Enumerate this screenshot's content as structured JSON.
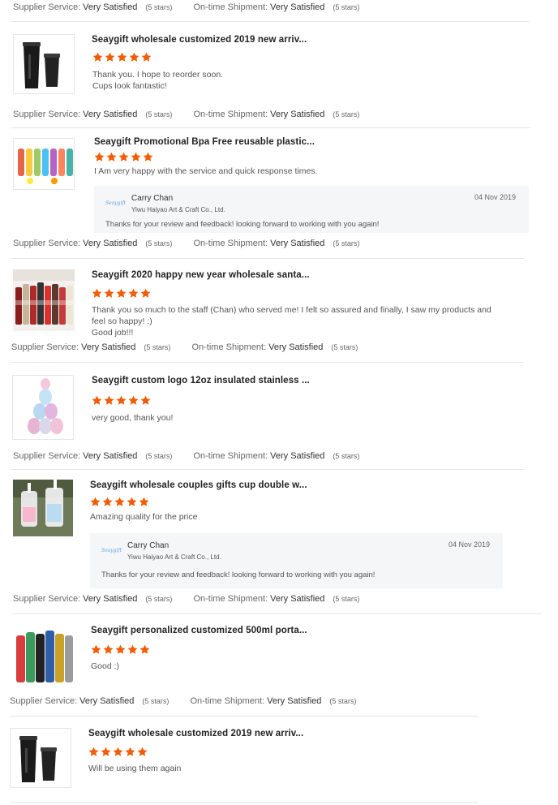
{
  "common": {
    "supplier_label": "Supplier Service:",
    "shipment_label": "On-time Shipment:",
    "satisfied": "Very Satisfied",
    "five_stars": "(5 stars)"
  },
  "colors": {
    "star": "#f25c05",
    "divider": "#e6e6e6",
    "reply_bg": "#f5f6f8"
  },
  "reviews": [
    {
      "title": "Seaygift wholesale customized 2019 new arriv...",
      "rating": 5,
      "comment": [
        "Thank you. I hope to reorder soon.",
        "Cups look fantastic!"
      ]
    },
    {
      "title": "Seaygift Promotional Bpa Free reusable plastic...",
      "rating": 5,
      "comment": [
        "I Am very happy with the service and quick response times."
      ],
      "reply": {
        "logo": "Seaygift",
        "name": "Carry Chan",
        "company": "Yiwu Haiyao Art & Craft Co., Ltd.",
        "date": "04 Nov 2019",
        "message": "Thanks for your review and feedback!  looking forward to working with you again!"
      }
    },
    {
      "title": "Seaygift 2020 happy new year wholesale santa...",
      "rating": 5,
      "comment": [
        "Thank you so much to the staff (Chan) who served me!    I felt so assured and finally,  I saw my products and",
        "feel so happy! :)",
        "Good job!!!"
      ]
    },
    {
      "title": "Seaygift custom logo 12oz insulated stainless ...",
      "rating": 5,
      "comment": [
        "very good, thank you!"
      ]
    },
    {
      "title": "Seaygift wholesale couples gifts cup double w...",
      "rating": 5,
      "comment": [
        "Amazing quality for the price"
      ],
      "reply": {
        "logo": "Seaygift",
        "name": "Carry Chan",
        "company": "Yiwu Haiyao Art & Craft Co., Ltd.",
        "date": "04 Nov 2019",
        "message": "Thanks for your review and feedback!  looking forward to working with you again!"
      }
    },
    {
      "title": "Seaygift personalized customized 500ml porta...",
      "rating": 5,
      "comment": [
        "Good :)"
      ]
    },
    {
      "title": "Seaygift wholesale customized 2019 new arriv...",
      "rating": 5,
      "comment": [
        "Will be using them again"
      ]
    }
  ]
}
